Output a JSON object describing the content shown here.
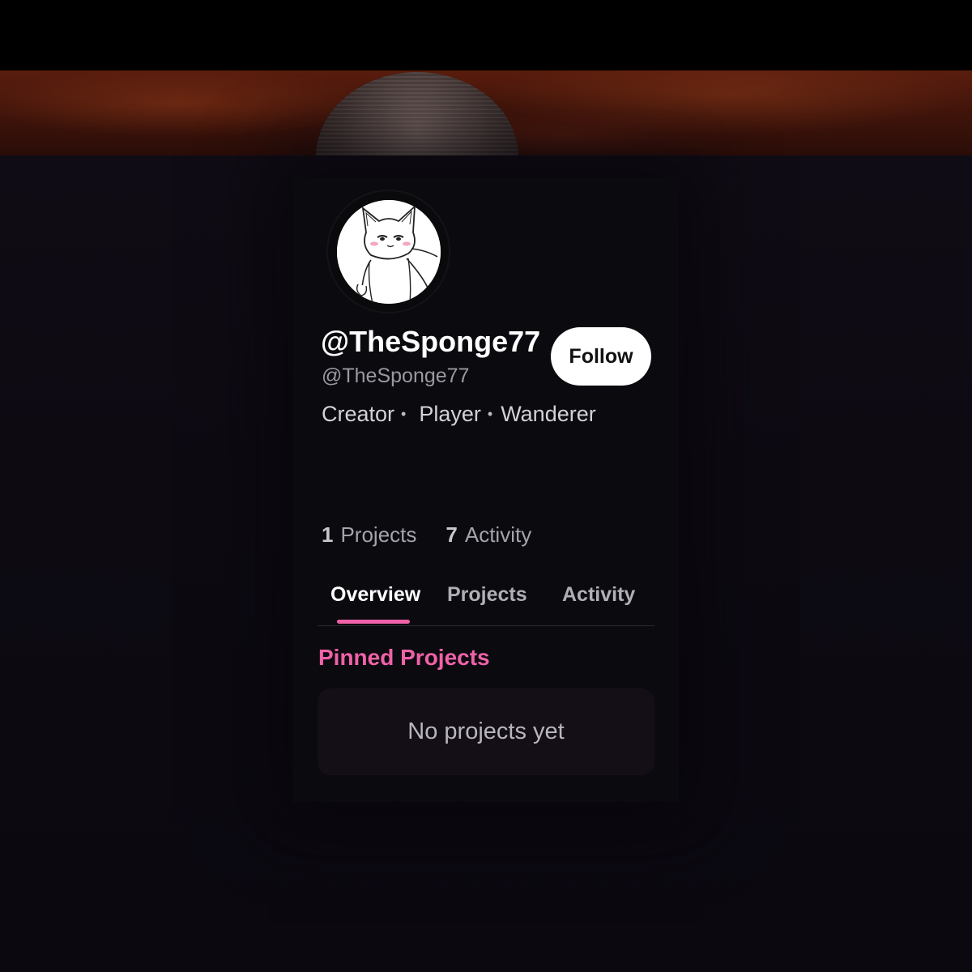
{
  "profile": {
    "display_name": "@TheSponge77",
    "handle": "@TheSponge77",
    "tags": [
      "Creator",
      "Player",
      "Wanderer"
    ],
    "tag_separator": "•",
    "follow_label": "Follow"
  },
  "stats": [
    {
      "count": "1",
      "label": "Projects"
    },
    {
      "count": "7",
      "label": "Activity"
    }
  ],
  "tabs": [
    {
      "label": "Overview",
      "active": true
    },
    {
      "label": "Projects",
      "active": false
    },
    {
      "label": "Activity",
      "active": false
    }
  ],
  "pinned": {
    "title": "Pinned Projects",
    "empty_text": "No projects yet"
  },
  "colors": {
    "accent": "#f062a8",
    "background": "#0c0810",
    "card": "#0b0a0f"
  }
}
